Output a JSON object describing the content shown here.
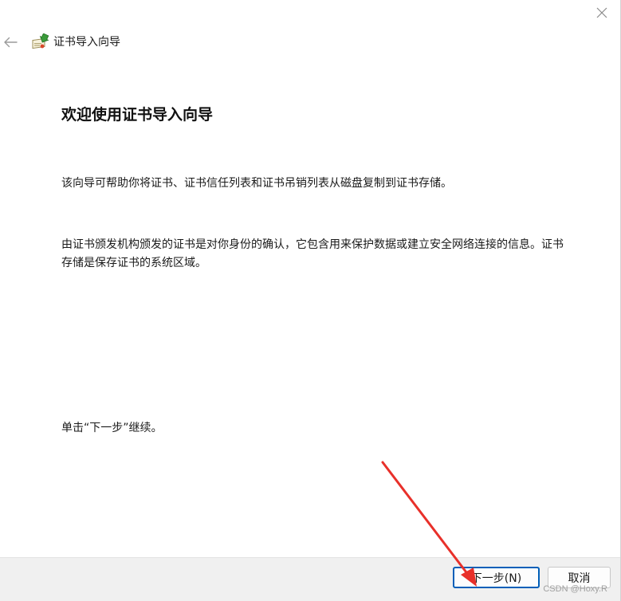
{
  "window": {
    "header_title": "证书导入向导",
    "icons": {
      "close": "close-icon",
      "back": "back-arrow-icon",
      "wizard": "certificate-import-icon"
    }
  },
  "content": {
    "title": "欢迎使用证书导入向导",
    "paragraphs": [
      "该向导可帮助你将证书、证书信任列表和证书吊销列表从磁盘复制到证书存储。",
      "由证书颁发机构颁发的证书是对你身份的确认，它包含用来保护数据或建立安全网络连接的信息。证书存储是保存证书的系统区域。",
      "单击“下一步”继续。"
    ]
  },
  "footer": {
    "next_label": "下一步(N)",
    "cancel_label": "取消"
  },
  "watermark": "CSDN @Hoxy.R",
  "colors": {
    "accent": "#005fb8",
    "footer_bg": "#f0f0f0",
    "annotation_arrow": "#e8302a"
  }
}
